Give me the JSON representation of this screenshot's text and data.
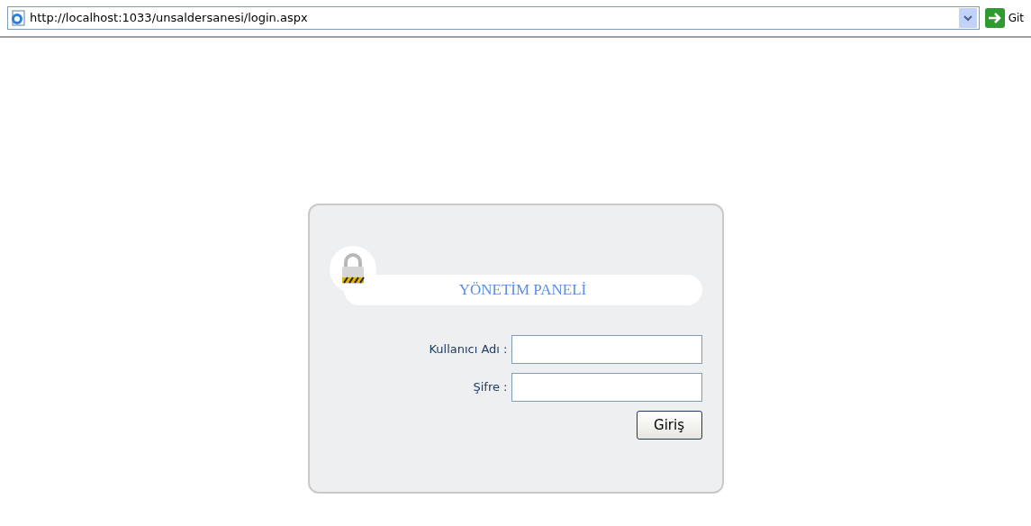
{
  "address_bar": {
    "url": "http://localhost:1033/unsaldersanesi/login.aspx",
    "go_label": "Git"
  },
  "login_panel": {
    "title": "YÖNETİM PANELİ",
    "fields": [
      {
        "label": "Kullanıcı Adı :"
      },
      {
        "label": "Şifre :"
      }
    ],
    "submit": "Giriş"
  }
}
